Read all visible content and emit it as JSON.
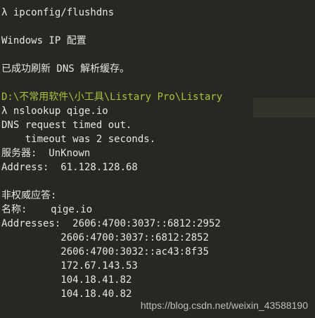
{
  "terminal": {
    "lines": [
      "λ ipconfig/flushdns",
      "",
      "Windows IP 配置",
      "",
      "已成功刷新 DNS 解析缓存。",
      "",
      "D:\\不常用软件\\小工具\\Listary Pro\\Listary",
      "λ nslookup qige.io",
      "DNS request timed out.",
      "    timeout was 2 seconds.",
      "服务器:  UnKnown",
      "Address:  61.128.128.68",
      "",
      "非权威应答:",
      "名称:    qige.io",
      "Addresses:  2606:4700:3037::6812:2952",
      "          2606:4700:3037::6812:2852",
      "          2606:4700:3032::ac43:8f35",
      "          172.67.143.53",
      "          104.18.41.82",
      "          104.18.40.82"
    ]
  },
  "watermark": "https://blog.csdn.net/weixin_43588190",
  "colors": {
    "background": "#272822",
    "text": "#e6e6e6",
    "path": "#a6c43a"
  }
}
